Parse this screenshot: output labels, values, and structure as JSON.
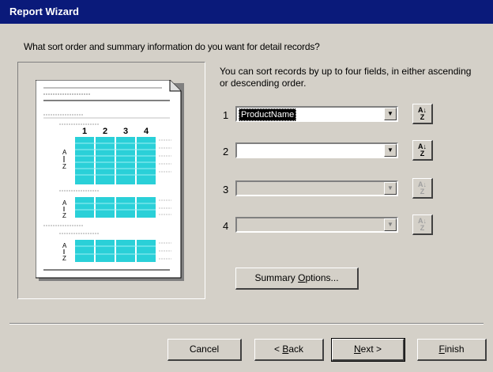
{
  "window": {
    "title": "Report Wizard"
  },
  "question": "What sort order and summary information do you want for detail records?",
  "instructions": "You can sort records by up to four fields, in either ascending or descending order.",
  "sort_fields": [
    {
      "number": "1",
      "value": "ProductName",
      "enabled": true
    },
    {
      "number": "2",
      "value": "",
      "enabled": true
    },
    {
      "number": "3",
      "value": "",
      "enabled": false
    },
    {
      "number": "4",
      "value": "",
      "enabled": false
    }
  ],
  "preview": {
    "column_numbers": [
      "1",
      "2",
      "3",
      "4"
    ]
  },
  "buttons": {
    "summary_options": {
      "pre": "Summary ",
      "key": "O",
      "post": "ptions..."
    },
    "cancel": "Cancel",
    "back": {
      "pre": "< ",
      "key": "B",
      "post": "ack"
    },
    "next": {
      "pre": "",
      "key": "N",
      "post": "ext >"
    },
    "finish": {
      "pre": "",
      "key": "F",
      "post": "inish"
    }
  }
}
